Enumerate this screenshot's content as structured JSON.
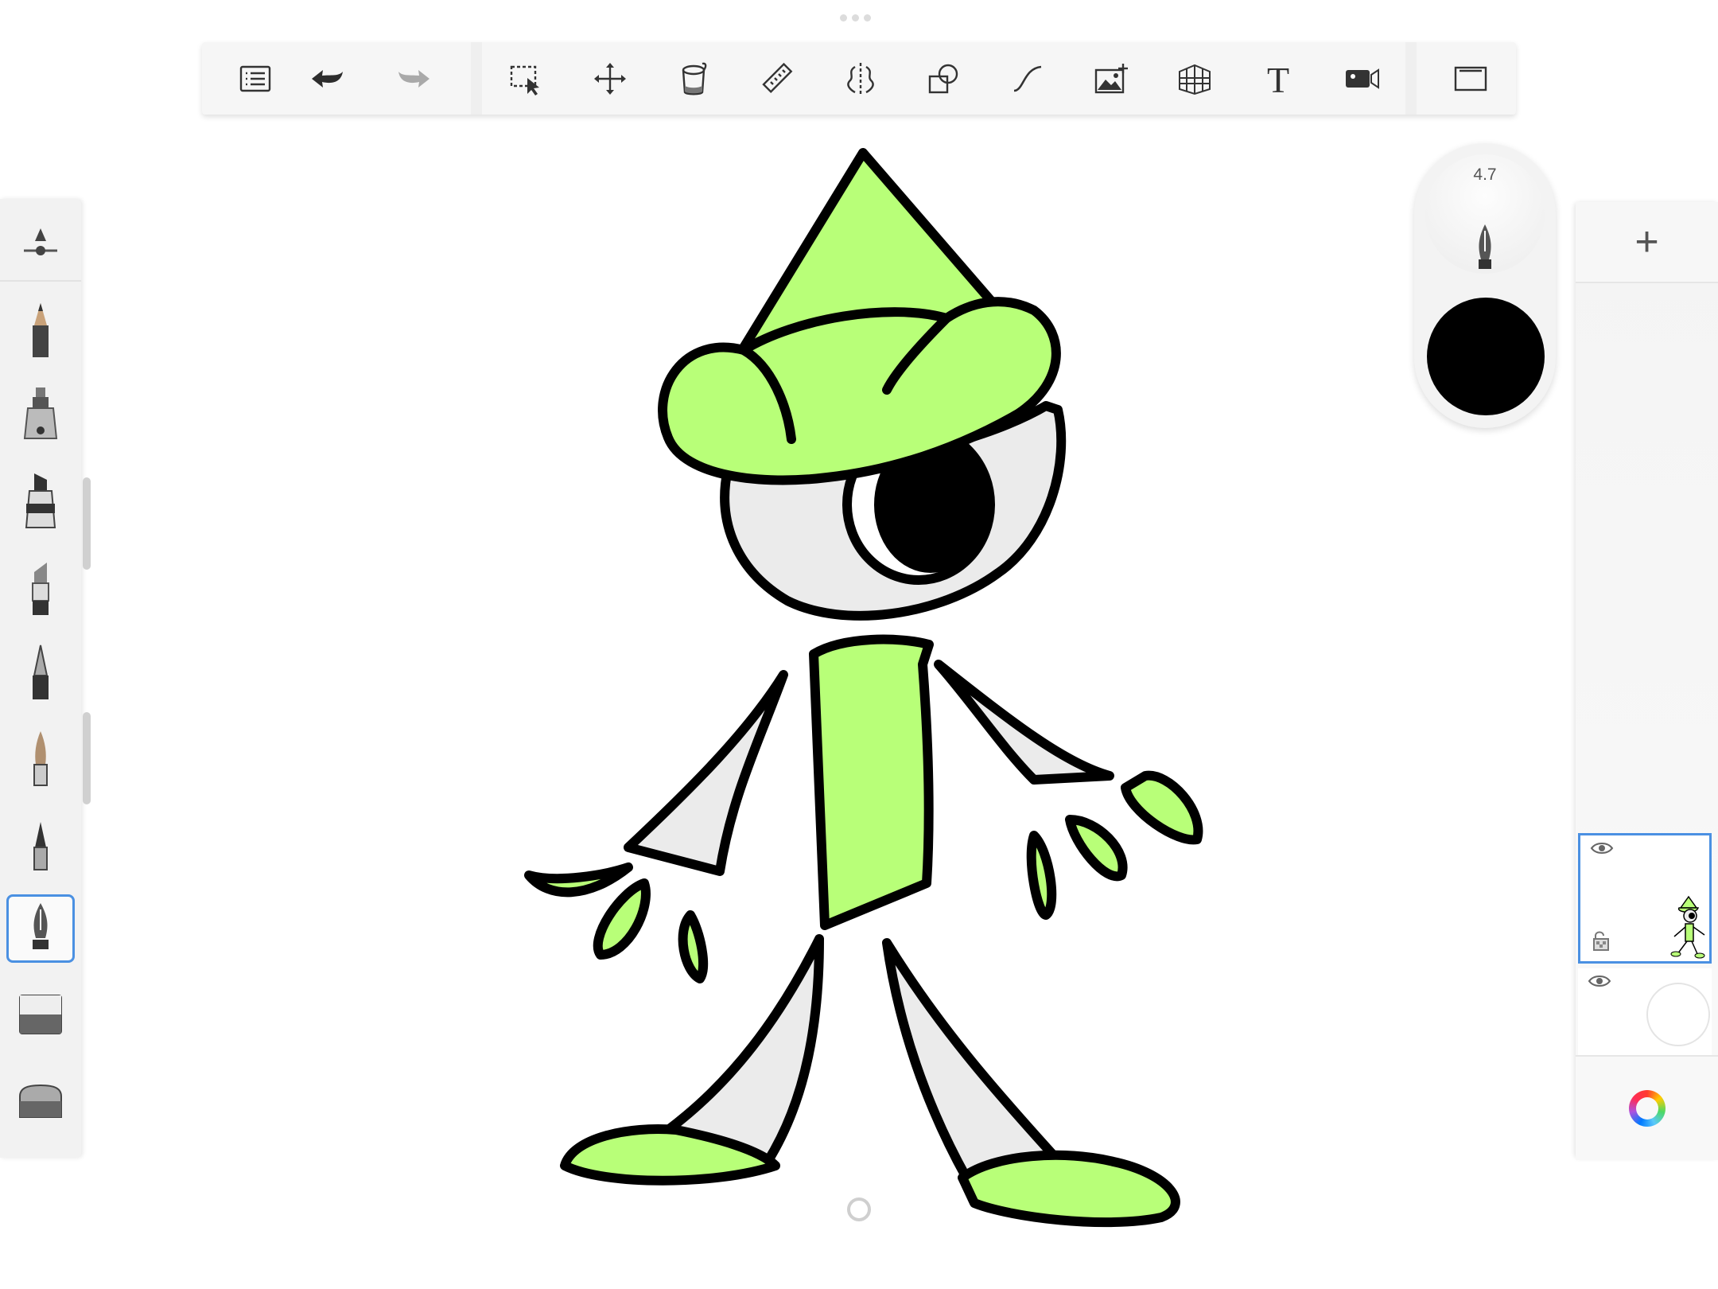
{
  "toolbar": {
    "buttons": [
      {
        "name": "list-icon"
      },
      {
        "name": "undo-icon"
      },
      {
        "name": "redo-icon"
      },
      {
        "name": "selection-icon"
      },
      {
        "name": "transform-icon"
      },
      {
        "name": "fill-icon"
      },
      {
        "name": "ruler-icon"
      },
      {
        "name": "symmetry-icon"
      },
      {
        "name": "shapes-icon"
      },
      {
        "name": "curve-icon"
      },
      {
        "name": "import-image-icon"
      },
      {
        "name": "perspective-icon"
      },
      {
        "name": "text-icon"
      },
      {
        "name": "record-icon"
      },
      {
        "name": "fullscreen-icon"
      }
    ]
  },
  "brushes": [
    "brush-settings",
    "pencil",
    "ink-pen",
    "marker",
    "chisel-marker",
    "ballpoint",
    "paintbrush",
    "airbrush",
    "fountain-pen",
    "soft-eraser",
    "hard-eraser"
  ],
  "puck": {
    "brush_size": "4.7",
    "color": "#000000"
  },
  "layers": {
    "add_label": "+"
  },
  "colors": {
    "body_green": "#b8ff78",
    "outline": "#000000",
    "limb_gray": "#ebebeb",
    "accent_blue": "#4a90e2"
  }
}
